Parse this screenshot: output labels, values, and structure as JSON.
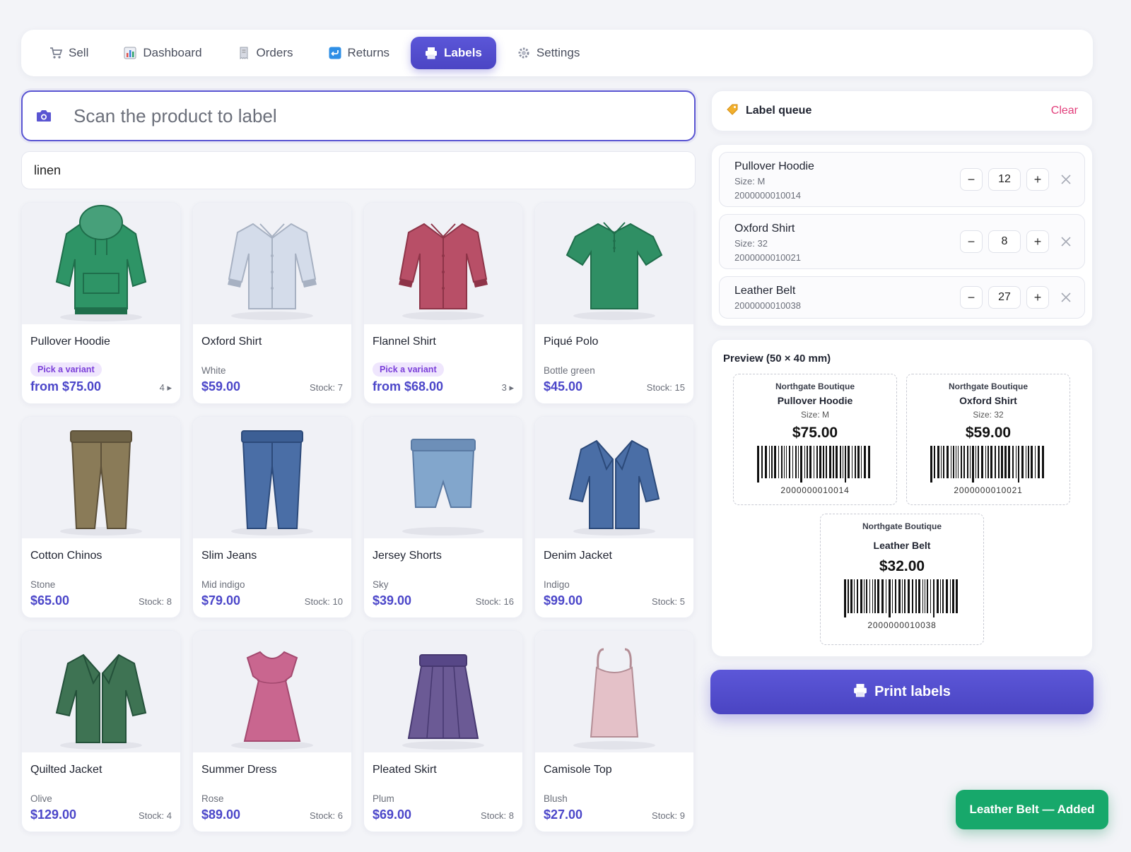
{
  "nav": {
    "tabs": [
      {
        "label": "Sell",
        "icon": "cart-icon"
      },
      {
        "label": "Dashboard",
        "icon": "chart-icon"
      },
      {
        "label": "Orders",
        "icon": "receipt-icon"
      },
      {
        "label": "Returns",
        "icon": "return-icon"
      },
      {
        "label": "Labels",
        "icon": "printer-icon",
        "active": true
      },
      {
        "label": "Settings",
        "icon": "gear-icon"
      }
    ],
    "accent": "#4f49c9"
  },
  "scan": {
    "placeholder": "Scan the product to label"
  },
  "filter": {
    "value": "linen"
  },
  "products": [
    {
      "name": "Pullover Hoodie",
      "pill": "Pick a variant",
      "price": "from $75.00",
      "meta": "4 ▸",
      "color": "#2e9466",
      "icon": "hoodie-icon"
    },
    {
      "name": "Oxford Shirt",
      "sub": "White",
      "price": "$59.00",
      "meta": "Stock: 7",
      "color": "#d4dcea",
      "icon": "shirt-icon"
    },
    {
      "name": "Flannel Shirt",
      "pill": "Pick a variant",
      "price": "from $68.00",
      "meta": "3 ▸",
      "color": "#b84f67",
      "icon": "shirt-icon"
    },
    {
      "name": "Piqué Polo",
      "sub": "Bottle green",
      "price": "$45.00",
      "meta": "Stock: 15",
      "color": "#2f8f64",
      "icon": "polo-icon"
    },
    {
      "name": "Cotton Chinos",
      "sub": "Stone",
      "price": "$65.00",
      "meta": "Stock: 8",
      "color": "#8a7b58",
      "icon": "pants-icon"
    },
    {
      "name": "Slim Jeans",
      "sub": "Mid indigo",
      "price": "$79.00",
      "meta": "Stock: 10",
      "color": "#4a6ea6",
      "icon": "pants-icon"
    },
    {
      "name": "Jersey Shorts",
      "sub": "Sky",
      "price": "$39.00",
      "meta": "Stock: 16",
      "color": "#82a6cc",
      "icon": "shorts-icon"
    },
    {
      "name": "Denim Jacket",
      "sub": "Indigo",
      "price": "$99.00",
      "meta": "Stock: 5",
      "color": "#4a6ea6",
      "icon": "jacket-icon"
    },
    {
      "name": "Quilted Jacket",
      "sub": "Olive",
      "price": "$129.00",
      "meta": "Stock: 4",
      "color": "#3e7353",
      "icon": "jacket-icon"
    },
    {
      "name": "Summer Dress",
      "sub": "Rose",
      "price": "$89.00",
      "meta": "Stock: 6",
      "color": "#c9668f",
      "icon": "dress-icon"
    },
    {
      "name": "Pleated Skirt",
      "sub": "Plum",
      "price": "$69.00",
      "meta": "Stock: 8",
      "color": "#6b5a95",
      "icon": "skirt-icon"
    },
    {
      "name": "Camisole Top",
      "sub": "Blush",
      "price": "$27.00",
      "meta": "Stock: 9",
      "color": "#e4c1c8",
      "icon": "camisole-icon"
    }
  ],
  "queue": {
    "title": "Label queue",
    "clear_label": "Clear",
    "items": [
      {
        "name": "Pullover Hoodie",
        "size": "Size: M",
        "code": "2000000010014",
        "qty": "12"
      },
      {
        "name": "Oxford Shirt",
        "size": "Size: 32",
        "code": "2000000010021",
        "qty": "8"
      },
      {
        "name": "Leather Belt",
        "code": "2000000010038",
        "qty": "27"
      }
    ]
  },
  "preview": {
    "title": "Preview (50 × 40 mm)",
    "labels": [
      {
        "store": "Northgate Boutique",
        "name": "Pullover Hoodie",
        "size": "Size: M",
        "price": "$75.00",
        "code": "2000000010014"
      },
      {
        "store": "Northgate Boutique",
        "name": "Oxford Shirt",
        "size": "Size: 32",
        "price": "$59.00",
        "code": "2000000010021"
      },
      {
        "store": "Northgate Boutique",
        "name": "Leather Belt",
        "price": "$32.00",
        "code": "2000000010038"
      }
    ]
  },
  "print": {
    "label": "Print labels"
  },
  "toast": {
    "text": "Leather Belt — Added",
    "color": "#17a86b"
  }
}
